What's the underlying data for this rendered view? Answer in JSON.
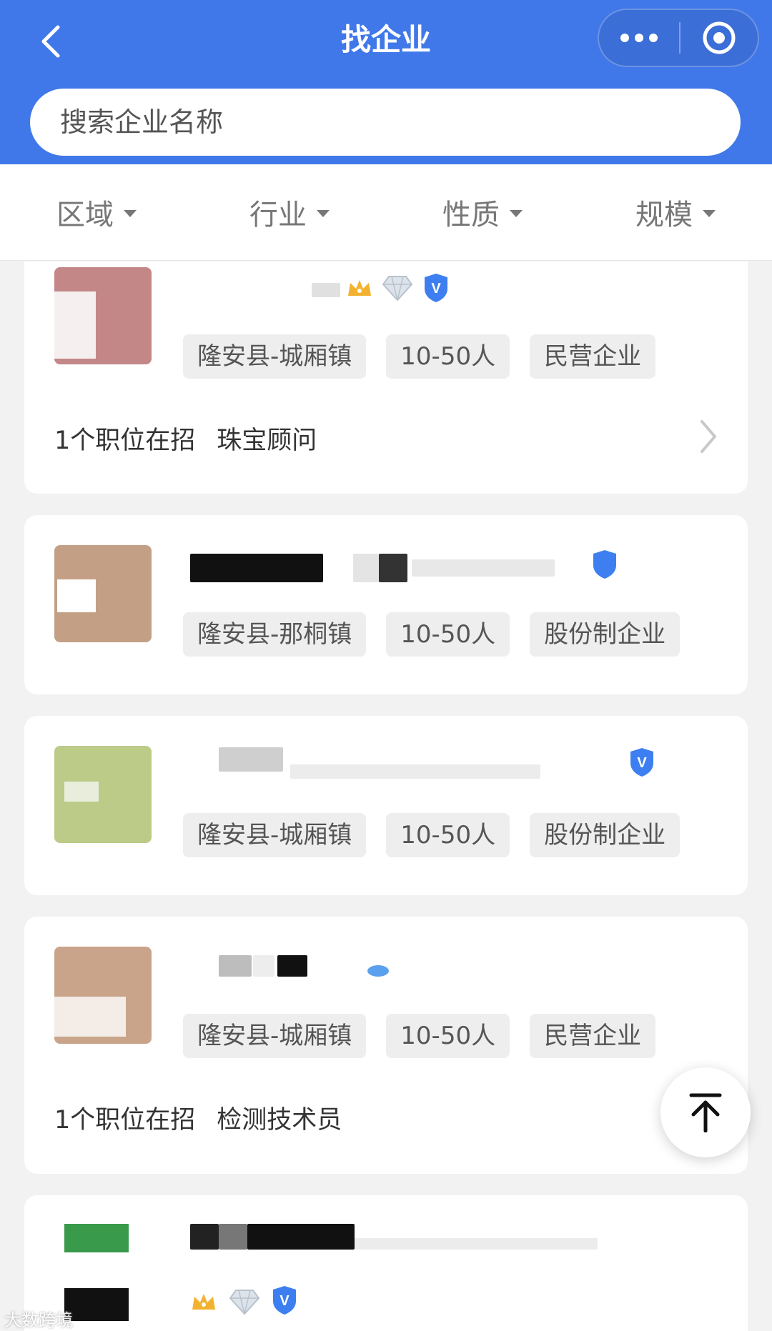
{
  "header": {
    "title": "找企业",
    "search_placeholder": "搜索企业名称"
  },
  "filters": [
    "区域",
    "行业",
    "性质",
    "规模"
  ],
  "companies": [
    {
      "tags": [
        "隆安县-城厢镇",
        "10-50人",
        "民营企业"
      ],
      "jobs_count": "1个职位在招",
      "job_title": "珠宝顾问",
      "logo_color": "#c48787"
    },
    {
      "tags": [
        "隆安县-那桐镇",
        "10-50人",
        "股份制企业"
      ],
      "logo_color": "#c3a085"
    },
    {
      "tags": [
        "隆安县-城厢镇",
        "10-50人",
        "股份制企业"
      ],
      "logo_color": "#bccb88"
    },
    {
      "tags": [
        "隆安县-城厢镇",
        "10-50人",
        "民营企业"
      ],
      "jobs_count": "1个职位在招",
      "job_title": "检测技术员",
      "logo_color": "#c9a48a"
    },
    {
      "logo_color": "#3a9a4b"
    }
  ],
  "watermark": "大数跨境",
  "colors": {
    "header_bg": "#4078ea",
    "badge_blue": "#3d7ff0",
    "crown_gold": "#f2b230"
  }
}
